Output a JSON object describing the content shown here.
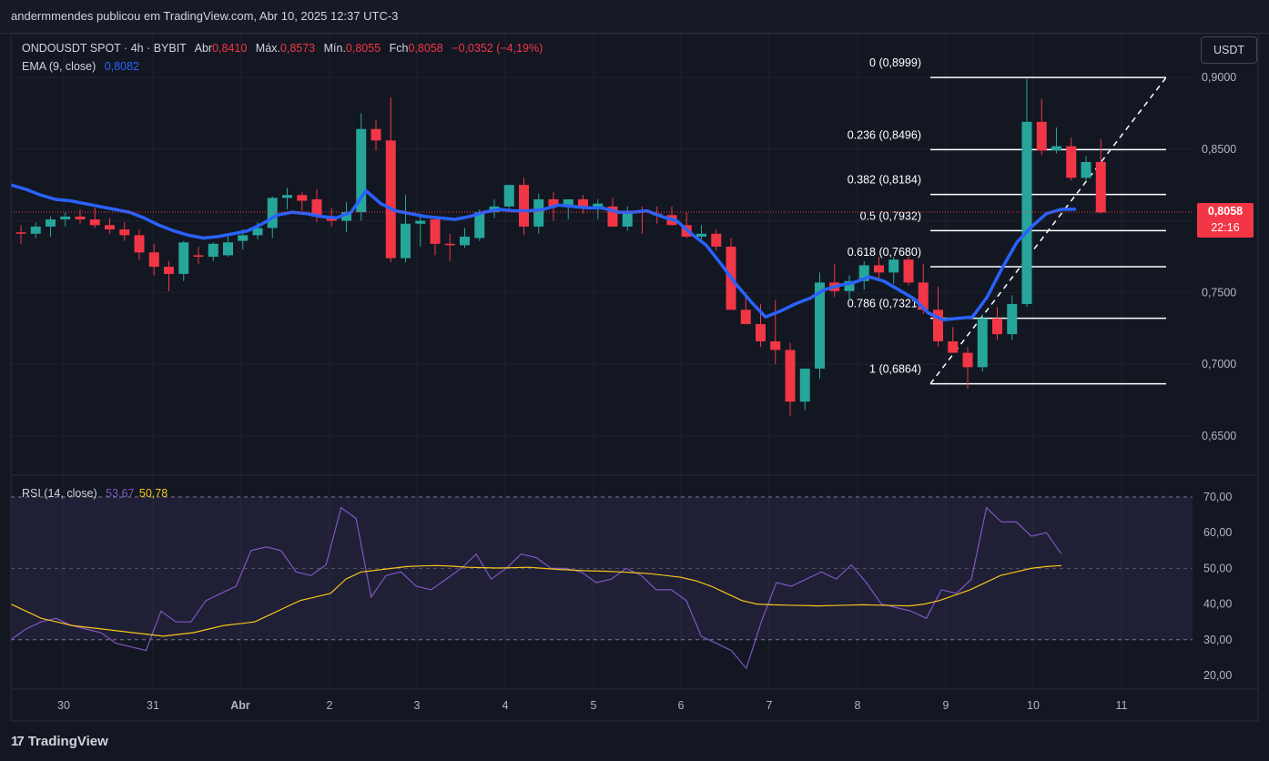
{
  "header": {
    "publisher_line": "andermmendes publicou em TradingView.com, Abr 10, 2025 12:37 UTC-3"
  },
  "legend": {
    "symbol": "ONDOUSDT SPOT · 4h · BYBIT",
    "open_label": "Abr",
    "open": "0,8410",
    "high_label": "Máx.",
    "high": "0,8573",
    "low_label": "Mín.",
    "low": "0,8055",
    "close_label": "Fch",
    "close": "0,8058",
    "change": "−0,0352 (−4,19%)",
    "ema_label": "EMA (9, close)",
    "ema_value": "0,8082",
    "rsi_label": "RSI (14, close)",
    "rsi_value": "53,67",
    "rsi_ma_value": "50,78"
  },
  "currency_button": "USDT",
  "price_badge": {
    "price": "0,8058",
    "countdown": "22:16"
  },
  "logo": {
    "mark": "17",
    "text": "TradingView"
  },
  "colors": {
    "up": "#26a69a",
    "down": "#f23645",
    "ema": "#2962ff",
    "rsi": "#7e57c2",
    "rsi_ma": "#f7c51b",
    "background": "#131722"
  },
  "chart_data": [
    {
      "type": "candlestick",
      "x_ticks": [
        "30",
        "31",
        "Abr",
        "2",
        "3",
        "4",
        "5",
        "6",
        "7",
        "8",
        "9",
        "10",
        "11"
      ],
      "y_ticks": [
        "0,9000",
        "0,8500",
        "0,8000",
        "0,7500",
        "0,7000",
        "0,6500"
      ],
      "y_range": [
        0.63,
        0.92
      ],
      "candles_ohlc": [
        [
          0.792,
          0.797,
          0.784,
          0.791
        ],
        [
          0.791,
          0.799,
          0.788,
          0.796
        ],
        [
          0.796,
          0.803,
          0.789,
          0.801
        ],
        [
          0.801,
          0.806,
          0.796,
          0.803
        ],
        [
          0.803,
          0.808,
          0.798,
          0.801
        ],
        [
          0.801,
          0.809,
          0.795,
          0.797
        ],
        [
          0.797,
          0.802,
          0.791,
          0.794
        ],
        [
          0.794,
          0.799,
          0.786,
          0.79
        ],
        [
          0.79,
          0.794,
          0.773,
          0.778
        ],
        [
          0.778,
          0.784,
          0.762,
          0.768
        ],
        [
          0.768,
          0.772,
          0.751,
          0.763
        ],
        [
          0.763,
          0.786,
          0.758,
          0.785
        ],
        [
          0.776,
          0.782,
          0.77,
          0.775
        ],
        [
          0.775,
          0.785,
          0.772,
          0.784
        ],
        [
          0.776,
          0.789,
          0.775,
          0.785
        ],
        [
          0.786,
          0.794,
          0.78,
          0.79
        ],
        [
          0.79,
          0.799,
          0.787,
          0.795
        ],
        [
          0.795,
          0.817,
          0.788,
          0.816
        ],
        [
          0.816,
          0.823,
          0.808,
          0.818
        ],
        [
          0.818,
          0.82,
          0.807,
          0.814
        ],
        [
          0.815,
          0.822,
          0.799,
          0.803
        ],
        [
          0.802,
          0.809,
          0.796,
          0.8
        ],
        [
          0.8,
          0.813,
          0.792,
          0.806
        ],
        [
          0.806,
          0.875,
          0.8,
          0.864
        ],
        [
          0.864,
          0.87,
          0.849,
          0.856
        ],
        [
          0.856,
          0.886,
          0.771,
          0.774
        ],
        [
          0.774,
          0.818,
          0.771,
          0.798
        ],
        [
          0.798,
          0.805,
          0.782,
          0.8
        ],
        [
          0.801,
          0.803,
          0.776,
          0.784
        ],
        [
          0.784,
          0.791,
          0.772,
          0.783
        ],
        [
          0.783,
          0.795,
          0.781,
          0.789
        ],
        [
          0.788,
          0.808,
          0.786,
          0.806
        ],
        [
          0.806,
          0.815,
          0.802,
          0.81
        ],
        [
          0.81,
          0.824,
          0.807,
          0.825
        ],
        [
          0.825,
          0.83,
          0.79,
          0.796
        ],
        [
          0.796,
          0.819,
          0.791,
          0.815
        ],
        [
          0.815,
          0.82,
          0.8,
          0.81
        ],
        [
          0.81,
          0.815,
          0.801,
          0.815
        ],
        [
          0.815,
          0.818,
          0.805,
          0.809
        ],
        [
          0.809,
          0.815,
          0.801,
          0.812
        ],
        [
          0.81,
          0.816,
          0.796,
          0.796
        ],
        [
          0.796,
          0.81,
          0.793,
          0.807
        ],
        [
          0.807,
          0.81,
          0.791,
          0.806
        ],
        [
          0.805,
          0.81,
          0.798,
          0.804
        ],
        [
          0.804,
          0.81,
          0.797,
          0.797
        ],
        [
          0.797,
          0.806,
          0.788,
          0.789
        ],
        [
          0.789,
          0.797,
          0.785,
          0.791
        ],
        [
          0.791,
          0.794,
          0.779,
          0.782
        ],
        [
          0.782,
          0.788,
          0.758,
          0.738
        ],
        [
          0.738,
          0.75,
          0.728,
          0.728
        ],
        [
          0.728,
          0.742,
          0.712,
          0.716
        ],
        [
          0.716,
          0.745,
          0.7,
          0.71
        ],
        [
          0.71,
          0.715,
          0.664,
          0.674
        ],
        [
          0.674,
          0.695,
          0.668,
          0.697
        ],
        [
          0.697,
          0.764,
          0.69,
          0.757
        ],
        [
          0.757,
          0.77,
          0.747,
          0.751
        ],
        [
          0.751,
          0.762,
          0.745,
          0.758
        ],
        [
          0.758,
          0.772,
          0.752,
          0.769
        ],
        [
          0.769,
          0.775,
          0.76,
          0.764
        ],
        [
          0.764,
          0.775,
          0.756,
          0.773
        ],
        [
          0.773,
          0.775,
          0.755,
          0.757
        ],
        [
          0.757,
          0.77,
          0.735,
          0.738
        ],
        [
          0.738,
          0.754,
          0.712,
          0.716
        ],
        [
          0.716,
          0.726,
          0.708,
          0.708
        ],
        [
          0.708,
          0.712,
          0.683,
          0.698
        ],
        [
          0.698,
          0.735,
          0.695,
          0.732
        ],
        [
          0.732,
          0.74,
          0.717,
          0.721
        ],
        [
          0.721,
          0.748,
          0.717,
          0.742
        ],
        [
          0.742,
          0.899,
          0.74,
          0.869
        ],
        [
          0.869,
          0.885,
          0.846,
          0.849
        ],
        [
          0.849,
          0.865,
          0.847,
          0.852
        ],
        [
          0.852,
          0.858,
          0.828,
          0.83
        ],
        [
          0.83,
          0.845,
          0.828,
          0.841
        ],
        [
          0.841,
          0.857,
          0.805,
          0.8058
        ]
      ],
      "ema_9": [
        0.825,
        0.822,
        0.818,
        0.815,
        0.814,
        0.812,
        0.81,
        0.808,
        0.806,
        0.802,
        0.797,
        0.793,
        0.79,
        0.788,
        0.789,
        0.791,
        0.793,
        0.798,
        0.804,
        0.806,
        0.805,
        0.803,
        0.802,
        0.806,
        0.821,
        0.812,
        0.807,
        0.805,
        0.803,
        0.802,
        0.801,
        0.803,
        0.806,
        0.808,
        0.807,
        0.807,
        0.808,
        0.811,
        0.81,
        0.809,
        0.809,
        0.806,
        0.806,
        0.807,
        0.803,
        0.8,
        0.791,
        0.783,
        0.77,
        0.756,
        0.744,
        0.733,
        0.737,
        0.742,
        0.746,
        0.752,
        0.755,
        0.757,
        0.761,
        0.758,
        0.752,
        0.746,
        0.736,
        0.731,
        0.732,
        0.733,
        0.747,
        0.767,
        0.785,
        0.796,
        0.805,
        0.808,
        0.8082
      ],
      "fibonacci": [
        {
          "label": "0 (0,8999)",
          "value": 0.8999
        },
        {
          "label": "0.236 (0,8496)",
          "value": 0.8496
        },
        {
          "label": "0.382 (0,8184)",
          "value": 0.8184
        },
        {
          "label": "0.5 (0,7932)",
          "value": 0.7932
        },
        {
          "label": "0.618 (0,7680)",
          "value": 0.768
        },
        {
          "label": "0.786 (0,7321)",
          "value": 0.7321
        },
        {
          "label": "1 (0,6864)",
          "value": 0.6864
        }
      ]
    },
    {
      "type": "line",
      "title": "RSI (14, close)",
      "y_ticks": [
        "70,00",
        "60,00",
        "50,00",
        "40,00",
        "30,00",
        "20,00"
      ],
      "y_range": [
        17,
        73
      ],
      "bands": [
        30,
        70
      ],
      "series": [
        {
          "name": "RSI",
          "values": [
            30,
            33,
            35,
            36,
            34,
            33,
            32,
            29,
            28,
            27,
            38,
            35,
            35,
            41,
            43,
            45,
            55,
            56,
            55,
            49,
            48,
            51,
            67,
            64,
            42,
            48,
            49,
            45,
            44,
            47,
            50,
            54,
            47,
            50,
            54,
            53,
            50,
            50,
            49,
            46,
            47,
            50,
            48,
            44,
            44,
            41,
            31,
            29,
            27,
            22,
            35,
            46,
            45,
            47,
            49,
            47,
            51,
            46,
            40,
            39,
            38,
            36,
            44,
            43,
            47,
            67,
            63,
            63,
            59,
            60,
            54
          ]
        },
        {
          "name": "MA",
          "values": [
            40,
            38,
            36,
            35,
            34,
            33.5,
            33,
            32.5,
            32,
            31.5,
            31,
            31.5,
            32,
            33,
            34,
            34.5,
            35,
            37,
            39,
            41,
            42,
            43,
            47,
            49,
            49.5,
            50,
            50.5,
            50.7,
            50.8,
            50.6,
            50.3,
            50.2,
            50.1,
            50.2,
            50.3,
            50,
            49.7,
            49.5,
            49.3,
            49.2,
            49,
            48.8,
            48.5,
            48,
            47.5,
            46.5,
            45,
            43,
            41,
            40,
            39.8,
            39.7,
            39.6,
            39.5,
            39.6,
            39.7,
            39.8,
            39.7,
            39.6,
            39.5,
            40,
            41,
            42.5,
            44,
            46,
            48,
            49,
            50,
            50.5,
            50.78
          ]
        }
      ]
    }
  ]
}
